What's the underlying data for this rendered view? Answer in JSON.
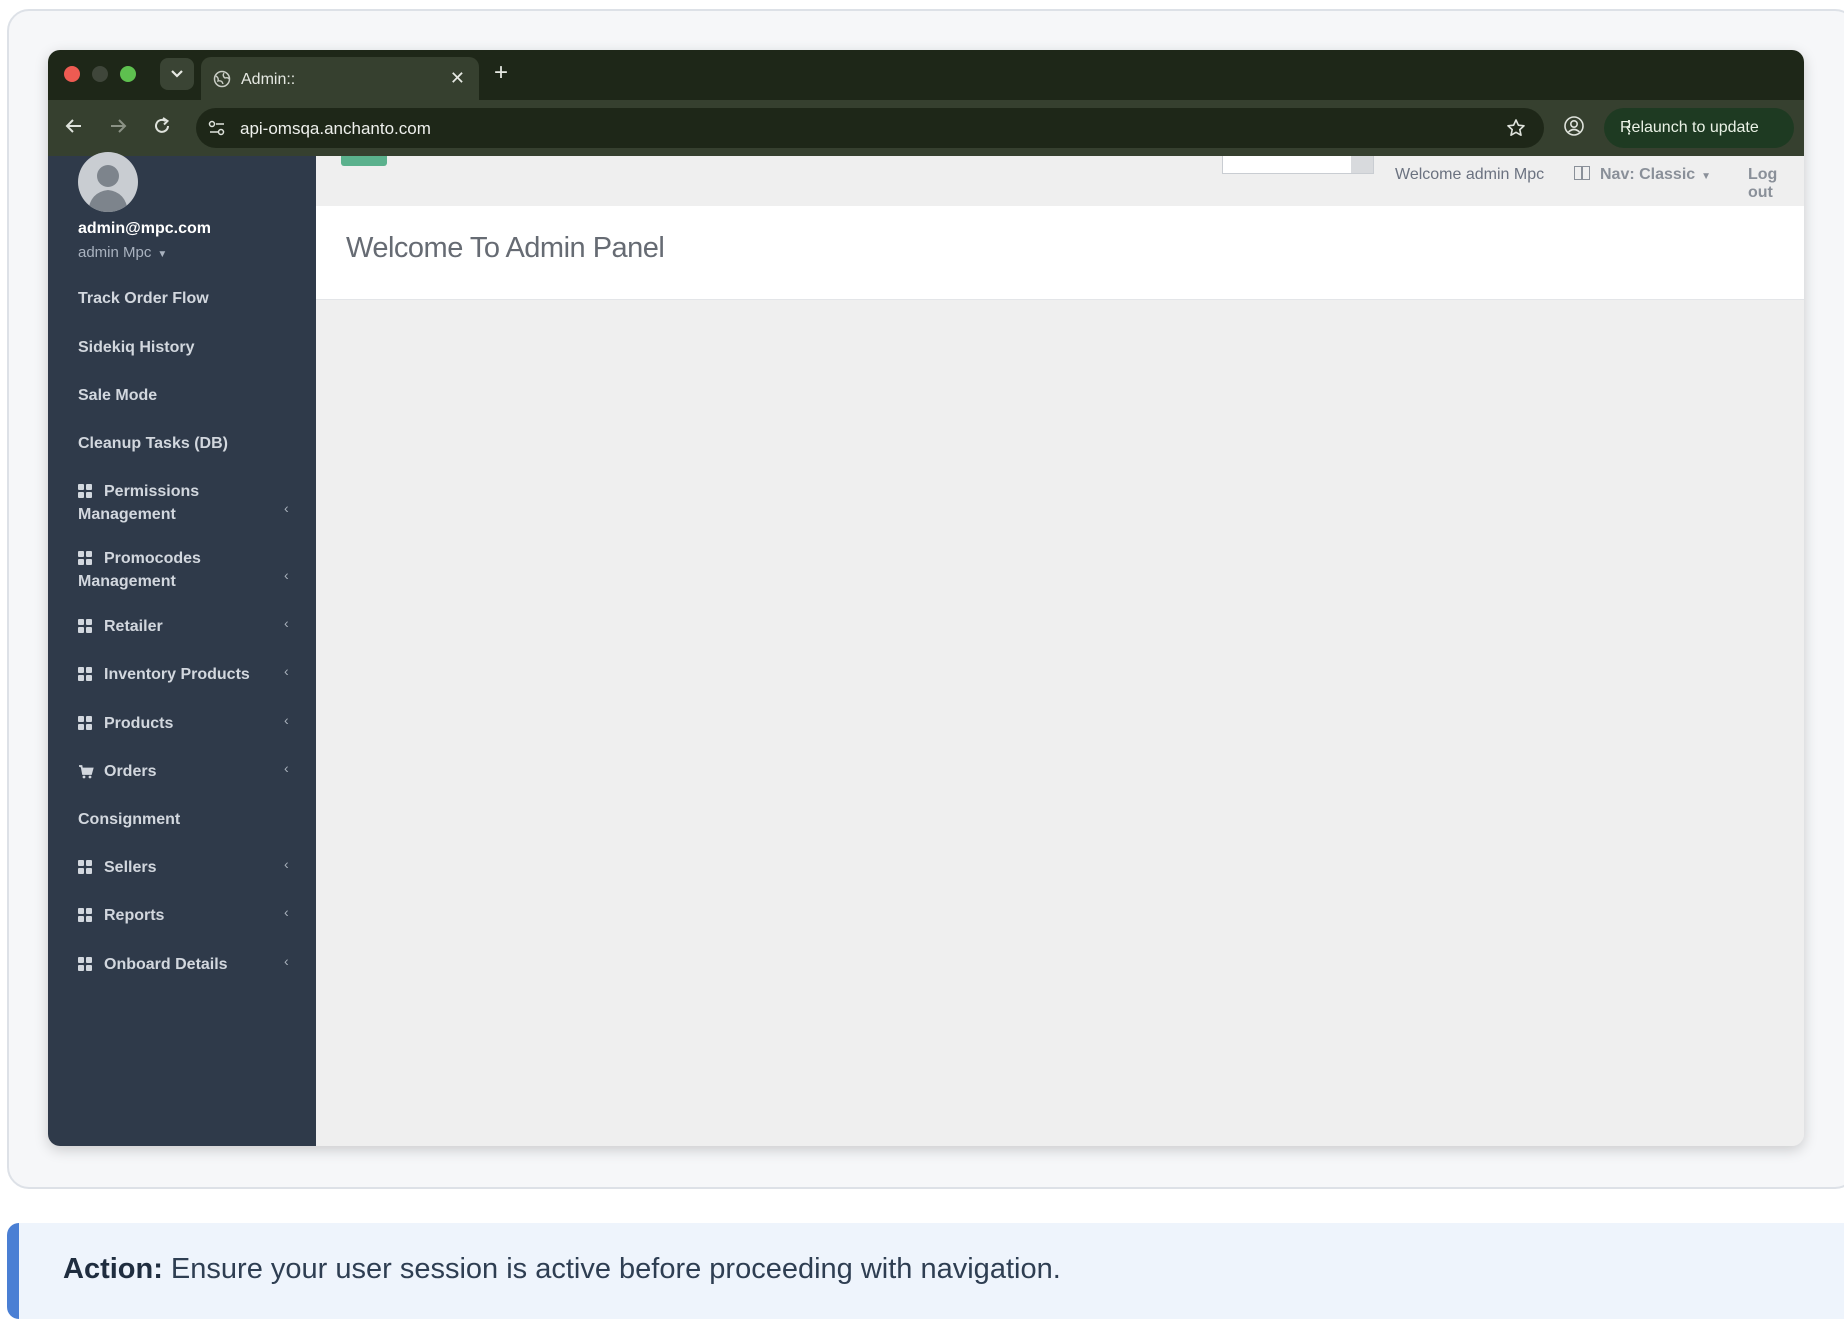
{
  "browser": {
    "tab_title": "Admin::",
    "url": "api-omsqa.anchanto.com",
    "relaunch_label": "Relaunch to update"
  },
  "user": {
    "email": "admin@mpc.com",
    "name": "admin Mpc"
  },
  "topbar": {
    "welcome": "Welcome admin Mpc",
    "nav_mode": "Nav: Classic",
    "logout": "Log out"
  },
  "main": {
    "title": "Welcome To Admin Panel"
  },
  "sidebar": {
    "items": [
      {
        "label": "Track Order Flow",
        "icon": "none",
        "expandable": false
      },
      {
        "label": "Sidekiq History",
        "icon": "none",
        "expandable": false
      },
      {
        "label": "Sale Mode",
        "icon": "none",
        "expandable": false
      },
      {
        "label": "Cleanup Tasks (DB)",
        "icon": "none",
        "expandable": false
      },
      {
        "label": "Permissions Management",
        "icon": "grid-icon",
        "expandable": true
      },
      {
        "label": "Promocodes Management",
        "icon": "grid-icon",
        "expandable": true
      },
      {
        "label": "Retailer",
        "icon": "grid-icon",
        "expandable": true
      },
      {
        "label": "Inventory Products",
        "icon": "grid-icon",
        "expandable": true
      },
      {
        "label": "Products",
        "icon": "grid-icon",
        "expandable": true
      },
      {
        "label": "Orders",
        "icon": "cart-icon",
        "expandable": true
      },
      {
        "label": "Consignment",
        "icon": "none",
        "expandable": false
      },
      {
        "label": "Sellers",
        "icon": "grid-icon",
        "expandable": true
      },
      {
        "label": "Reports",
        "icon": "grid-icon",
        "expandable": true
      },
      {
        "label": "Onboard Details",
        "icon": "grid-icon",
        "expandable": true
      }
    ]
  },
  "action": {
    "prefix": "Action:",
    "text": " Ensure your user session is active before proceeding with navigation."
  },
  "colors": {
    "sidebar_bg": "#2f3a4a",
    "chrome_dark": "#1e2718",
    "accent_green": "#5bb18d",
    "banner_accent": "#4a7fd4"
  }
}
